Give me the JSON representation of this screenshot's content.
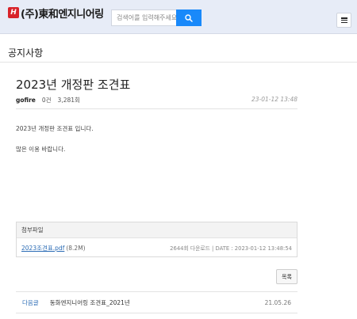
{
  "header": {
    "logo_mark": "H",
    "logo_text": "(주)東和엔지니어링",
    "search_placeholder": "검색어를 입력해주세요",
    "search_icon": "search-icon",
    "menu_icon": "hamburger-icon",
    "accent_color": "#1989fa"
  },
  "page": {
    "section_title": "공지사항"
  },
  "post": {
    "title": "2023년 개정판 조견표",
    "author": "gofire",
    "comments": "0건",
    "views": "3,281회",
    "date": "23-01-12 13:48",
    "body_lines": [
      "2023년 개정판 조견표 입니다.",
      "많은 이용 바랍니다."
    ]
  },
  "attachments": {
    "header": "첨부파일",
    "files": [
      {
        "name": "2023조견표.pdf",
        "size": "(8.2M)",
        "info": "2644회 다운로드 | DATE : 2023-01-12 13:48:54"
      }
    ]
  },
  "actions": {
    "list_label": "목록"
  },
  "navigation": {
    "next_label": "다음글",
    "next_title": "동화엔지니어링 조견표_2021년",
    "next_date": "21.05.26"
  }
}
